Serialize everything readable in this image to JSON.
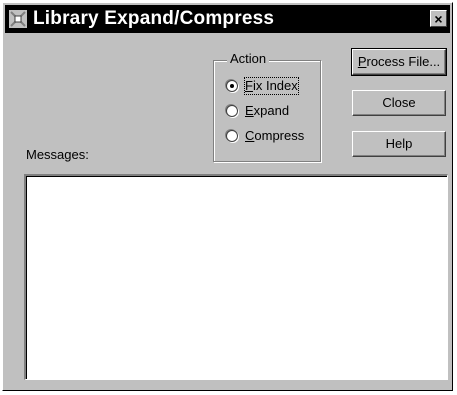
{
  "window": {
    "title": "Library Expand/Compress",
    "close_glyph": "×"
  },
  "action_group": {
    "legend": "Action",
    "options": [
      {
        "pre": "",
        "key": "F",
        "post": "ix Index",
        "checked": true
      },
      {
        "pre": "",
        "key": "E",
        "post": "xpand",
        "checked": false
      },
      {
        "pre": "",
        "key": "C",
        "post": "ompress",
        "checked": false
      }
    ]
  },
  "buttons": {
    "process": {
      "key": "P",
      "rest": "rocess File..."
    },
    "close": "Close",
    "help": "Help"
  },
  "messages": {
    "label": "Messages:",
    "content": ""
  }
}
